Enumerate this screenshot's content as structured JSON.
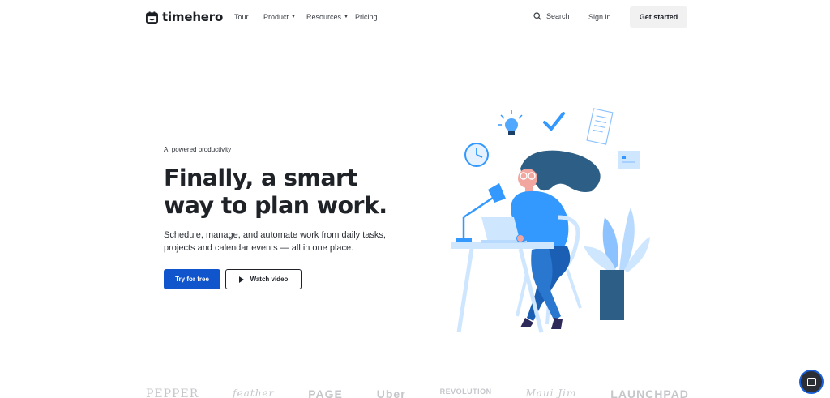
{
  "brand": {
    "name": "timehero"
  },
  "nav": {
    "items": [
      {
        "label": "Tour",
        "has_dropdown": false
      },
      {
        "label": "Product",
        "has_dropdown": true
      },
      {
        "label": "Resources",
        "has_dropdown": true
      },
      {
        "label": "Pricing",
        "has_dropdown": false
      }
    ],
    "search_label": "Search",
    "signin_label": "Sign in",
    "cta_label": "Get started"
  },
  "hero": {
    "eyebrow": "AI powered productivity",
    "headline_line1": "Finally, a smart",
    "headline_line2": "way to plan work.",
    "subtext": "Schedule, manage, and automate work from daily tasks, projects and calendar events — all in one place.",
    "primary_button": "Try for free",
    "secondary_button": "Watch video"
  },
  "logos": [
    "PEPPER",
    "feather",
    "PAGE",
    "Uber",
    "REVOLUTION",
    "Maui Jim",
    "LAUNCHPAD"
  ],
  "colors": {
    "accent": "#1155cc",
    "illustration_blue": "#3399ff",
    "illustration_navy": "#2d5f86",
    "text_dark": "#1f2328"
  },
  "icons": {
    "logo": "calendar-icon",
    "search": "search-icon",
    "play": "play-icon",
    "chat": "chat-icon"
  }
}
